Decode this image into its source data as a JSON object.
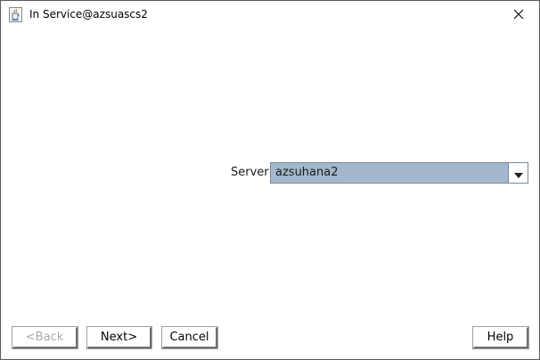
{
  "window": {
    "title": "In Service@azsuascs2"
  },
  "form": {
    "server_label": "Server",
    "server_value": "azsuhana2"
  },
  "buttons": {
    "back": "<Back",
    "next": "Next>",
    "cancel": "Cancel",
    "help": "Help"
  },
  "colors": {
    "select_background": "#a3b8cc",
    "disabled_text": "#a9a9a9"
  },
  "icons": {
    "app": "java-cup-icon",
    "close": "close-icon",
    "dropdown": "chevron-down-icon"
  }
}
